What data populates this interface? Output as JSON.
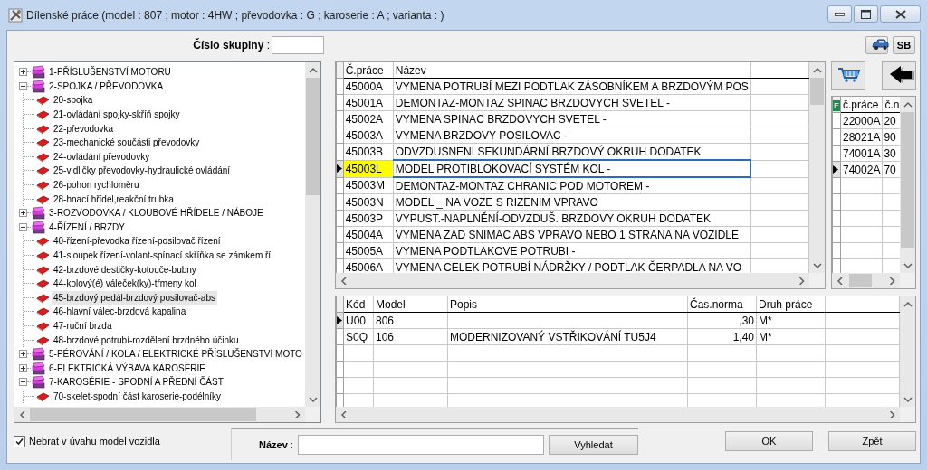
{
  "window": {
    "title": "Dílenské práce (model : 807 ; motor : 4HW ; převodovka : G ; karoserie : A ; varianta : )"
  },
  "group_number": {
    "label": "**Číslo skupiny** :"
  },
  "toolbar_buttons": [
    {
      "kind": "car"
    },
    {
      "kind": "text",
      "label": "SB"
    }
  ],
  "tree": {
    "items": [
      {
        "label": "1-PŘÍSLUŠENSTVÍ MOTORU",
        "expanded": false,
        "selected": false
      },
      {
        "label": "2-SPOJKA / PŘEVODOVKA",
        "expanded": true,
        "selected": false,
        "children": [
          {
            "label": "20-spojka",
            "selected": false
          },
          {
            "label": "21-ovládání spojky-skříň spojky",
            "selected": false
          },
          {
            "label": "22-převodovka",
            "selected": false
          },
          {
            "label": "23-mechanické součásti převodovky",
            "selected": false
          },
          {
            "label": "24-ovládání převodovky",
            "selected": false
          },
          {
            "label": "25-vidličky převodovky-hydraulické ovládání",
            "selected": false
          },
          {
            "label": "26-pohon rychloměru",
            "selected": false
          },
          {
            "label": "28-hnací hřídel,reakční trubka",
            "selected": false
          }
        ]
      },
      {
        "label": "3-ROZVODOVKA / KLOUBOVÉ HŘÍDELE / NÁBOJE",
        "expanded": false,
        "selected": false
      },
      {
        "label": "4-ŘÍZENÍ / BRZDY",
        "expanded": true,
        "selected": false,
        "children": [
          {
            "label": "40-řízení-převodka řízení-posilovač řízení",
            "selected": false
          },
          {
            "label": "41-sloupek řízení-volant-spínací skříňka se zámkem ří",
            "selected": false
          },
          {
            "label": "42-brzdové destičky-kotouče-bubny",
            "selected": false
          },
          {
            "label": "44-kolový(é) váleček(ky)-třmeny kol",
            "selected": false
          },
          {
            "label": "45-brzdový pedál-brzdový posilovač-abs",
            "selected": true
          },
          {
            "label": "46-hlavní válec-brzdová kapalina",
            "selected": false
          },
          {
            "label": "47-ruční brzda",
            "selected": false
          },
          {
            "label": "48-brzdové potrubí-rozdělení brzdného účinku",
            "selected": false
          }
        ]
      },
      {
        "label": "5-PÉROVÁNÍ / KOLA / ELEKTRICKÉ PŘÍSLUŠENSTVÍ MOTO",
        "expanded": false,
        "selected": false
      },
      {
        "label": "6-ELEKTRICKÁ VÝBAVA KAROSERIE",
        "expanded": false,
        "selected": false
      },
      {
        "label": "7-KAROSÉRIE - SPODNÍ A PŘEDNÍ ČÁST",
        "expanded": true,
        "selected": false,
        "children": [
          {
            "label": "70-skelet-spodní část karoserie-podélníky",
            "selected": false
          }
        ]
      }
    ]
  },
  "works_table": {
    "columns": [
      "Č.práce",
      "Název"
    ],
    "rows": [
      {
        "code": "45000A",
        "name": "VYMENA POTRUBÍ MEZI PODTLAK ZÁSOBNÍKEM A BRZDOVÝM POS",
        "selected": false
      },
      {
        "code": "45001A",
        "name": "DEMONTAZ-MONTAZ SPINAC BRZDOVYCH SVETEL -",
        "selected": false
      },
      {
        "code": "45002A",
        "name": "VYMENA SPINAC BRZDOVYCH SVETEL -",
        "selected": false
      },
      {
        "code": "45003A",
        "name": "VYMENA BRZDOVY POSILOVAC -",
        "selected": false
      },
      {
        "code": "45003B",
        "name": "ODVZDUSNENI SEKUNDÁRNÍ BRZDOVÝ OKRUH DODATEK",
        "selected": false
      },
      {
        "code": "45003L",
        "name": "MODEL PROTIBLOKOVACÍ SYSTÉM KOL -",
        "selected": true
      },
      {
        "code": "45003M",
        "name": "DEMONTAZ-MONTAZ CHRANIC POD MOTOREM -",
        "selected": false
      },
      {
        "code": "45003N",
        "name": "MODEL _ NA VOZE S RIZENIM VPRAVO",
        "selected": false
      },
      {
        "code": "45003P",
        "name": "VYPUST.-NAPLNĚNÍ-ODVZDUŠ. BRZDOVY OKRUH DODATEK",
        "selected": false
      },
      {
        "code": "45004A",
        "name": "VYMENA ZAD SNIMAC ABS VPRAVO NEBO 1 STRANA NA VOZIDLE",
        "selected": false
      },
      {
        "code": "45005A",
        "name": "VYMENA PODTLAKOVE POTRUBI -",
        "selected": false
      },
      {
        "code": "45006A",
        "name": "VYMENA CELEK POTRUBÍ NÁDRŽKY / PODTLAK ČERPADLA NA VO",
        "selected": false
      }
    ]
  },
  "selected_works": {
    "marker": "E",
    "columns": [
      "č.práce",
      "č.n"
    ],
    "rows": [
      {
        "code": "22000A",
        "number": "20",
        "selected": false
      },
      {
        "code": "28021A",
        "number": "90",
        "selected": false
      },
      {
        "code": "74001A",
        "number": "30",
        "selected": false
      },
      {
        "code": "74002A",
        "number": "70",
        "selected": true
      }
    ]
  },
  "operations": {
    "columns": [
      "Kód",
      "Model",
      "Popis",
      "Čas.norma",
      "Druh práce"
    ],
    "rows": [
      {
        "code": "U00",
        "model": "806",
        "time": ",30",
        "type": "M*",
        "selected": true
      },
      {
        "code": "S0Q",
        "model": "106",
        "description": "MODERNIZOVANÝ VSTŘIKOVÁNÍ TU5J4",
        "time": "1,40",
        "type": "M*",
        "selected": false
      }
    ]
  },
  "ignore_model": {
    "label": "Nebrat v úvahu model vozidla",
    "checked": true
  },
  "search": {
    "label": "**Název** :",
    "button": {
      "label": "Vyhledat"
    }
  },
  "buttons": [
    {
      "label": "OK"
    },
    {
      "label": "Zpět"
    }
  ]
}
